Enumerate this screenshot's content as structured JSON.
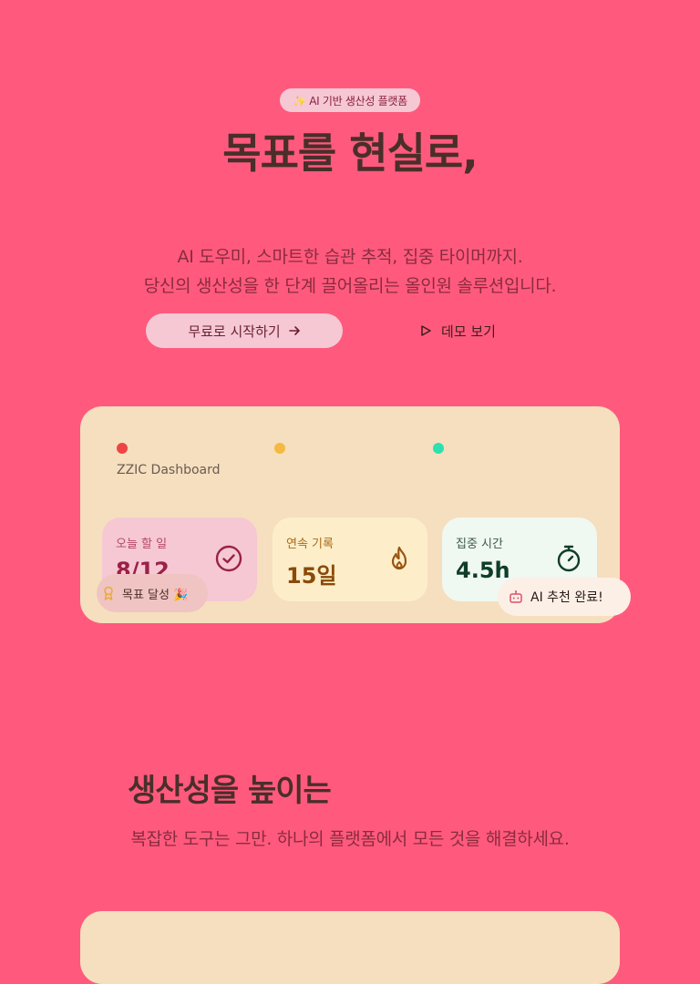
{
  "hero": {
    "badge": "✨ AI 기반 생산성 플랫폼",
    "title": "목표를 현실로,",
    "subtitle_lines": [
      "AI 도우미, 스마트한 습관 추적, 집중 타이머까지.",
      "당신의 생산성을 한 단계 끌어올리는 올인원 솔루션입니다."
    ],
    "primary_cta": "무료로 시작하기",
    "secondary_cta": "데모 보기"
  },
  "dashboard": {
    "title": "ZZIC Dashboard",
    "window_dot_colors": [
      "#EF4444",
      "#F5B942",
      "#2DE0B0"
    ],
    "cards": [
      {
        "label": "오늘 할 일",
        "value": "8/12",
        "icon": "check-circle-icon",
        "bg": "#F5C8D4",
        "label_color": "#B5476A",
        "value_color": "#9B2146",
        "icon_color": "#9B2146"
      },
      {
        "label": "연속 기록",
        "value": "15일",
        "icon": "flame-icon",
        "bg": "#FDEEC9",
        "label_color": "#A86A1A",
        "value_color": "#8A4A08",
        "icon_color": "#9A5410"
      },
      {
        "label": "집중 시간",
        "value": "4.5h",
        "icon": "stopwatch-icon",
        "bg": "#F0F8F2",
        "label_color": "#3A5A46",
        "value_color": "#0F3D2A",
        "icon_color": "#0F3D2A"
      }
    ],
    "chip_goal": "목표 달성 🎉",
    "chip_ai": "AI 추천 완료!"
  },
  "features": {
    "title": "생산성을 높이는",
    "subtitle": "복잡한 도구는 그만. 하나의 플랫폼에서 모든 것을 해결하세요."
  }
}
